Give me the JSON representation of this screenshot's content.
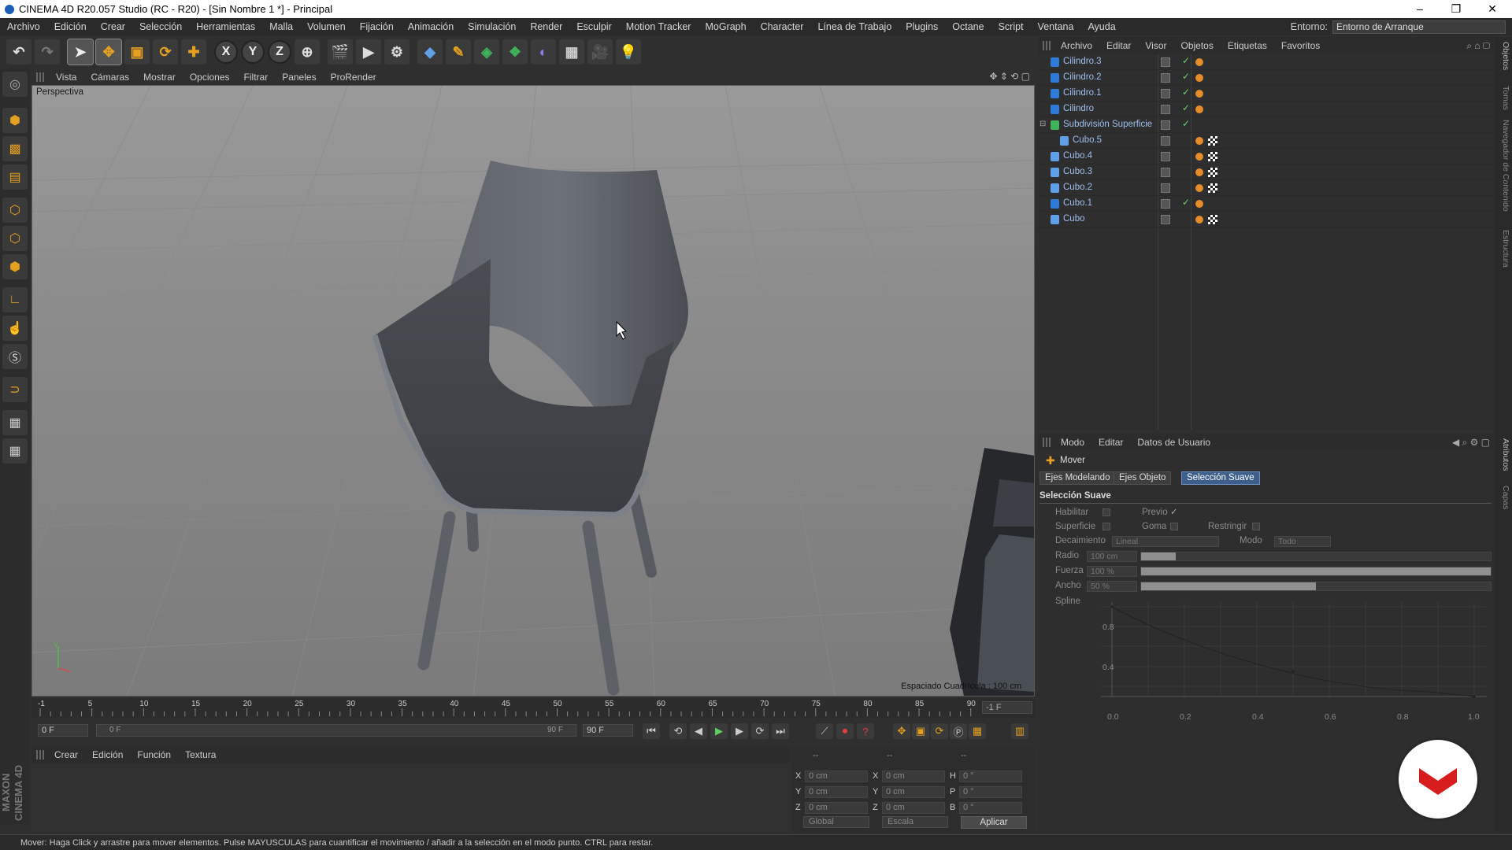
{
  "titlebar": {
    "title": "CINEMA 4D R20.057 Studio (RC - R20) - [Sin Nombre 1 *] - Principal"
  },
  "menu": [
    "Archivo",
    "Edición",
    "Crear",
    "Selección",
    "Herramientas",
    "Malla",
    "Volumen",
    "Fijación",
    "Animación",
    "Simulación",
    "Render",
    "Esculpir",
    "Motion Tracker",
    "MoGraph",
    "Character",
    "Línea de Trabajo",
    "Plugins",
    "Octane",
    "Script",
    "Ventana",
    "Ayuda"
  ],
  "environment": {
    "label": "Entorno:",
    "value": "Entorno de Arranque"
  },
  "toolbar": {
    "axis_x": "X",
    "axis_y": "Y",
    "axis_z": "Z"
  },
  "viewport": {
    "menu": [
      "Vista",
      "Cámaras",
      "Mostrar",
      "Opciones",
      "Filtrar",
      "Paneles",
      "ProRender"
    ],
    "label": "Perspectiva",
    "grid_spacing": "Espaciado Cuadrícula : 100 cm",
    "axis_y": "Y"
  },
  "timeline": {
    "ticks": [
      "5",
      "10",
      "15",
      "20",
      "25",
      "30",
      "35",
      "40",
      "45",
      "50",
      "55",
      "60",
      "65",
      "70",
      "75",
      "80",
      "85",
      "90"
    ],
    "start_tick": "-1",
    "frame_end_label": "-1 F",
    "current": "0 F",
    "range_start": "0 F",
    "range_end": "90 F",
    "max": "90 F"
  },
  "materials": {
    "menu": [
      "Crear",
      "Edición",
      "Función",
      "Textura"
    ]
  },
  "coords": {
    "headers": [
      "--",
      "--",
      "--"
    ],
    "rows": [
      {
        "a": "X",
        "av": "0 cm",
        "b": "X",
        "bv": "0 cm",
        "c": "H",
        "cv": "0 °"
      },
      {
        "a": "Y",
        "av": "0 cm",
        "b": "Y",
        "bv": "0 cm",
        "c": "P",
        "cv": "0 °"
      },
      {
        "a": "Z",
        "av": "0 cm",
        "b": "Z",
        "bv": "0 cm",
        "c": "B",
        "cv": "0 °"
      }
    ],
    "mode": "Global",
    "scale": "Escala",
    "apply": "Aplicar"
  },
  "status": {
    "text": "Mover: Haga Click y arrastre para mover elementos. Pulse MAYUSCULAS para cuantificar el movimiento / añadir a la selección en el modo punto. CTRL para restar."
  },
  "objects": {
    "menu": [
      "Archivo",
      "Editar",
      "Visor",
      "Objetos",
      "Etiquetas",
      "Favoritos"
    ],
    "items": [
      {
        "name": "Cilindro.3",
        "indent": 0,
        "color": "#2d7bd6",
        "check": "✓",
        "tags": 1
      },
      {
        "name": "Cilindro.2",
        "indent": 0,
        "color": "#2d7bd6",
        "check": "✓",
        "tags": 1
      },
      {
        "name": "Cilindro.1",
        "indent": 0,
        "color": "#2d7bd6",
        "check": "✓",
        "tags": 1
      },
      {
        "name": "Cilindro",
        "indent": 0,
        "color": "#2d7bd6",
        "check": "✓",
        "tags": 1
      },
      {
        "name": "Subdivisión Superficie",
        "indent": 0,
        "color": "#3fb35a",
        "check": "✓",
        "tags": 0
      },
      {
        "name": "Cubo.5",
        "indent": 1,
        "color": "#5fa0e8",
        "check": "",
        "tags": 2
      },
      {
        "name": "Cubo.4",
        "indent": 0,
        "color": "#5fa0e8",
        "check": "",
        "tags": 2
      },
      {
        "name": "Cubo.3",
        "indent": 0,
        "color": "#5fa0e8",
        "check": "",
        "tags": 2
      },
      {
        "name": "Cubo.2",
        "indent": 0,
        "color": "#5fa0e8",
        "check": "",
        "tags": 2
      },
      {
        "name": "Cubo.1",
        "indent": 0,
        "color": "#2d7bd6",
        "check": "✓",
        "tags": 1
      },
      {
        "name": "Cubo",
        "indent": 0,
        "color": "#5fa0e8",
        "check": "",
        "tags": 2
      }
    ]
  },
  "attributes": {
    "menu": [
      "Modo",
      "Editar",
      "Datos de Usuario"
    ],
    "tool": "Mover",
    "tabs": [
      "Ejes Modelando",
      "Ejes Objeto",
      "Selección Suave"
    ],
    "active_tab": 2,
    "section": "Selección Suave",
    "habilitar": "Habilitar",
    "previo": "Previo",
    "previo_check": "✓",
    "superficie": "Superficie",
    "goma": "Goma",
    "restringir": "Restringir",
    "decaimiento": "Decaimiento",
    "decaimiento_value": "Lineal",
    "modo": "Modo",
    "modo_value": "Todo",
    "radio": "Radio",
    "radio_value": "100 cm",
    "radio_fraction": 0.1,
    "fuerza": "Fuerza",
    "fuerza_value": "100 %",
    "fuerza_fraction": 1.0,
    "ancho": "Ancho",
    "ancho_value": "50 %",
    "ancho_fraction": 0.5,
    "spline": "Spline",
    "spline_x_ticks": [
      "0.0",
      "0.2",
      "0.4",
      "0.6",
      "0.8",
      "1.0"
    ],
    "spline_y_ticks": [
      "0.8",
      "0.4"
    ]
  },
  "right_tabs": [
    "Objetos",
    "Tomas",
    "Navegador de Contenido",
    "Estructura",
    "Atributos",
    "Capas"
  ]
}
